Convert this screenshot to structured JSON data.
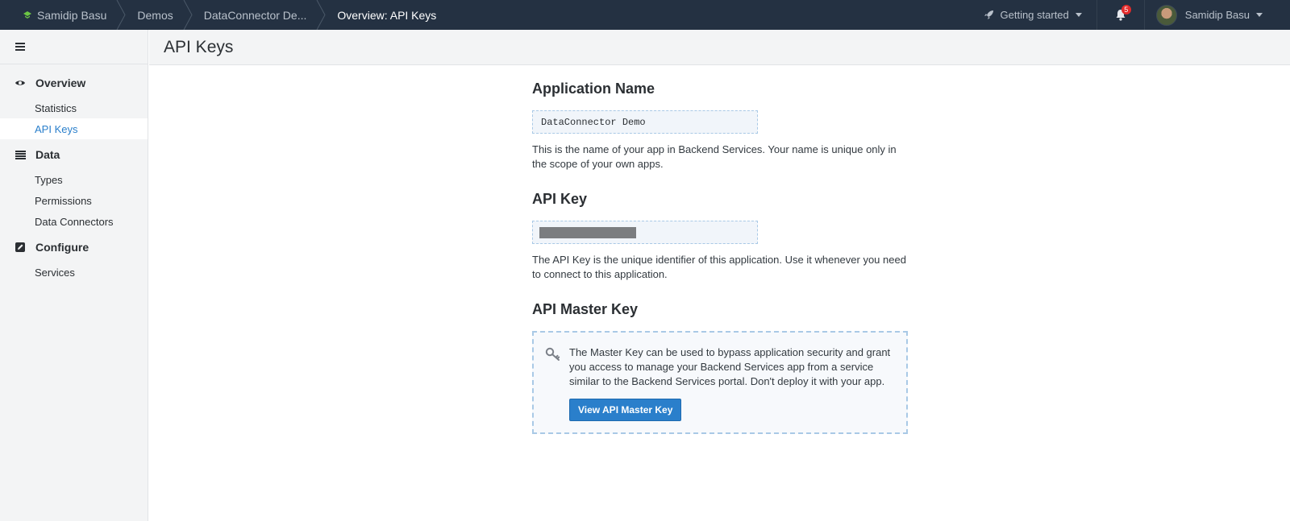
{
  "breadcrumbs": [
    {
      "label": "Samidip Basu"
    },
    {
      "label": "Demos"
    },
    {
      "label": "DataConnector De..."
    },
    {
      "label": "Overview: API Keys"
    }
  ],
  "topbar": {
    "getting_started": "Getting started",
    "notification_count": "5",
    "user_name": "Samidip Basu"
  },
  "sidebar": {
    "groups": [
      {
        "label": "Overview",
        "icon": "eye-icon",
        "items": [
          "Statistics",
          "API Keys"
        ]
      },
      {
        "label": "Data",
        "icon": "list-icon",
        "items": [
          "Types",
          "Permissions",
          "Data Connectors"
        ]
      },
      {
        "label": "Configure",
        "icon": "edit-icon",
        "items": [
          "Services"
        ]
      }
    ],
    "active_item": "API Keys"
  },
  "page": {
    "title": "API Keys"
  },
  "app_name": {
    "heading": "Application Name",
    "value": "DataConnector Demo",
    "description": "This is the name of your app in Backend Services. Your name is unique only in the scope of your own apps."
  },
  "api_key": {
    "heading": "API Key",
    "description": "The API Key is the unique identifier of this application. Use it whenever you need to connect to this application."
  },
  "master_key": {
    "heading": "API Master Key",
    "description": "The Master Key can be used to bypass application security and grant you access to manage your Backend Services app from a service similar to the Backend Services portal. Don't deploy it with your app.",
    "button_label": "View API Master Key"
  },
  "colors": {
    "topbar_bg": "#243142",
    "accent": "#2a7fcb",
    "brand_green": "#6cc644",
    "badge_red": "#e32b2b"
  }
}
